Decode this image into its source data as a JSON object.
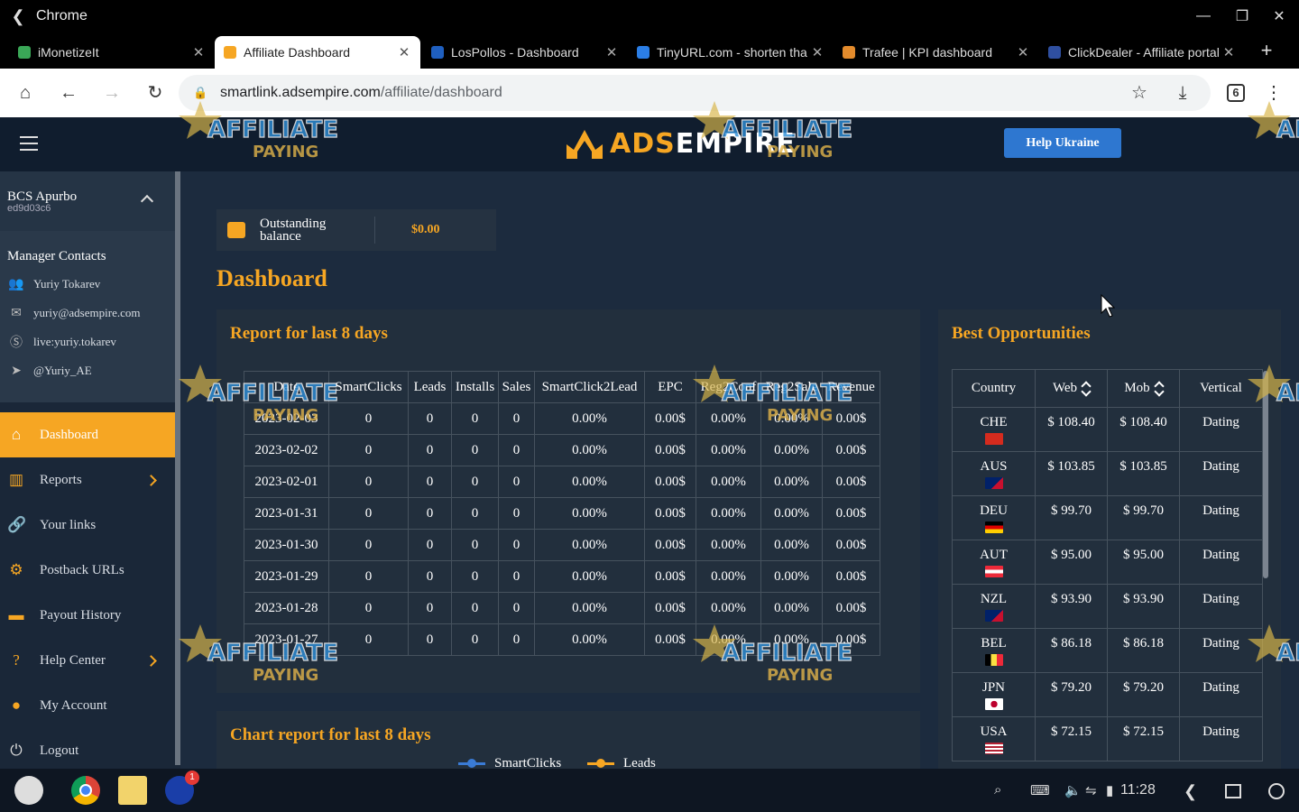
{
  "window": {
    "title": "Chrome",
    "minimize": "—",
    "restore": "❐",
    "close": "✕"
  },
  "tabs": [
    {
      "label": "iMonetizeIt",
      "color": "#3aa757"
    },
    {
      "label": "Affiliate Dashboard",
      "color": "#f6a623"
    },
    {
      "label": "LosPollos - Dashboard",
      "color": "#1f5fbf"
    },
    {
      "label": "TinyURL.com - shorten tha",
      "color": "#2b7ee6"
    },
    {
      "label": "Trafee | KPI dashboard",
      "color": "#e38b2c"
    },
    {
      "label": "ClickDealer - Affiliate portal",
      "color": "#2f4fa0"
    }
  ],
  "toolbar": {
    "url_domain": "smartlink.adsempire.com",
    "url_path": "/affiliate/dashboard",
    "ext_count": "6"
  },
  "header": {
    "logo_ads": "ADS",
    "logo_empire": "EMPIRE",
    "help_button": "Help Ukraine"
  },
  "user": {
    "name": "BCS Apurbo",
    "id": "ed9d03c6"
  },
  "manager": {
    "title": "Manager Contacts",
    "rows": [
      {
        "icon": "people-icon",
        "text": "Yuriy Tokarev"
      },
      {
        "icon": "mail-icon",
        "text": "yuriy@adsempire.com"
      },
      {
        "icon": "skype-icon",
        "text": "live:yuriy.tokarev"
      },
      {
        "icon": "telegram-icon",
        "text": "@Yuriy_AE"
      }
    ]
  },
  "nav": [
    {
      "label": "Dashboard",
      "icon": "home-icon"
    },
    {
      "label": "Reports",
      "icon": "bar-chart-icon"
    },
    {
      "label": "Your links",
      "icon": "link-icon"
    },
    {
      "label": "Postback URLs",
      "icon": "link-settings-icon"
    },
    {
      "label": "Payout History",
      "icon": "card-icon"
    },
    {
      "label": "Help Center",
      "icon": "help-icon"
    },
    {
      "label": "My Account",
      "icon": "account-icon"
    },
    {
      "label": "Logout",
      "icon": "power-icon"
    }
  ],
  "balance": {
    "label_1": "Outstanding",
    "label_2": "balance",
    "value": "$0.00"
  },
  "page_title": "Dashboard",
  "report": {
    "title": "Report for last 8 days",
    "columns": [
      "Date",
      "SmartClicks",
      "Leads",
      "Installs",
      "Sales",
      "SmartClick2Lead",
      "EPC",
      "Reg2Conf",
      "Reg2Sale",
      "Revenue"
    ],
    "rows": [
      [
        "2023-02-03",
        "0",
        "0",
        "0",
        "0",
        "0.00%",
        "0.00$",
        "0.00%",
        "0.00%",
        "0.00$"
      ],
      [
        "2023-02-02",
        "0",
        "0",
        "0",
        "0",
        "0.00%",
        "0.00$",
        "0.00%",
        "0.00%",
        "0.00$"
      ],
      [
        "2023-02-01",
        "0",
        "0",
        "0",
        "0",
        "0.00%",
        "0.00$",
        "0.00%",
        "0.00%",
        "0.00$"
      ],
      [
        "2023-01-31",
        "0",
        "0",
        "0",
        "0",
        "0.00%",
        "0.00$",
        "0.00%",
        "0.00%",
        "0.00$"
      ],
      [
        "2023-01-30",
        "0",
        "0",
        "0",
        "0",
        "0.00%",
        "0.00$",
        "0.00%",
        "0.00%",
        "0.00$"
      ],
      [
        "2023-01-29",
        "0",
        "0",
        "0",
        "0",
        "0.00%",
        "0.00$",
        "0.00%",
        "0.00%",
        "0.00$"
      ],
      [
        "2023-01-28",
        "0",
        "0",
        "0",
        "0",
        "0.00%",
        "0.00$",
        "0.00%",
        "0.00%",
        "0.00$"
      ],
      [
        "2023-01-27",
        "0",
        "0",
        "0",
        "0",
        "0.00%",
        "0.00$",
        "0.00%",
        "0.00%",
        "0.00$"
      ]
    ]
  },
  "opportunities": {
    "title": "Best Opportunities",
    "columns": [
      "Country",
      "Web",
      "Mob",
      "Vertical"
    ],
    "rows": [
      {
        "country": "CHE",
        "web": "$ 108.40",
        "mob": "$ 108.40",
        "vertical": "Dating"
      },
      {
        "country": "AUS",
        "web": "$ 103.85",
        "mob": "$ 103.85",
        "vertical": "Dating"
      },
      {
        "country": "DEU",
        "web": "$ 99.70",
        "mob": "$ 99.70",
        "vertical": "Dating"
      },
      {
        "country": "AUT",
        "web": "$ 95.00",
        "mob": "$ 95.00",
        "vertical": "Dating"
      },
      {
        "country": "NZL",
        "web": "$ 93.90",
        "mob": "$ 93.90",
        "vertical": "Dating"
      },
      {
        "country": "BEL",
        "web": "$ 86.18",
        "mob": "$ 86.18",
        "vertical": "Dating"
      },
      {
        "country": "JPN",
        "web": "$ 79.20",
        "mob": "$ 79.20",
        "vertical": "Dating"
      },
      {
        "country": "USA",
        "web": "$ 72.15",
        "mob": "$ 72.15",
        "vertical": "Dating"
      }
    ]
  },
  "chart": {
    "title": "Chart report for last 8 days",
    "legend": [
      {
        "label": "SmartClicks",
        "color": "#3a7bd5"
      },
      {
        "label": "Leads",
        "color": "#f6a623"
      }
    ]
  },
  "watermark": {
    "line1": "AFFILIATE",
    "line2": "PAYING"
  },
  "taskbar": {
    "time": "11:28",
    "badge": "1"
  },
  "colors": {
    "accent": "#f6a623",
    "help_button": "#2e77d0"
  }
}
